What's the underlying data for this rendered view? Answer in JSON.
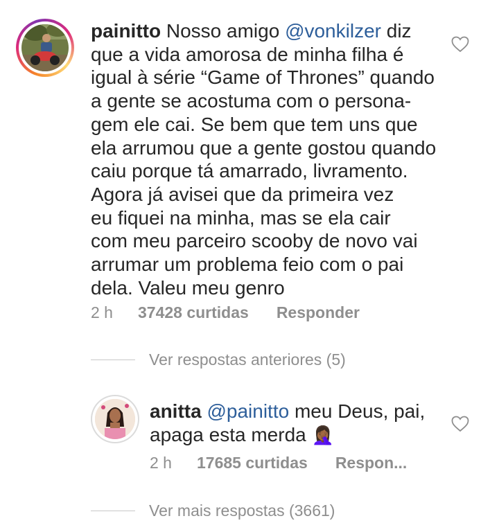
{
  "comment1": {
    "username": "painitto",
    "text_before_mention": "Nosso amigo ",
    "mention": "@vonkilzer",
    "text_after_mention": " diz\nque a vida amorosa de minha filha é\nigual à série “Game of Thrones” quando\na gente se acostuma com o persona-\ngem ele cai. Se bem que tem uns que\nela arrumou que a gente gostou quando\ncaiu porque tá amarrado, livramento.\nAgora já avisei que da primeira vez\neu fiquei na minha, mas se ela cair\ncom meu parceiro scooby de novo vai\narrumar um problema feio com o pai\ndela. Valeu meu genro",
    "time": "2 h",
    "likes": "37428 curtidas",
    "reply": "Responder",
    "like_icon": "heart-outline-icon"
  },
  "previous_replies": "Ver respostas anteriores (5)",
  "comment2": {
    "username": "anitta",
    "mention": "@painitto",
    "text": " meu Deus, pai,\napaga esta merda ",
    "emoji": "🤦🏾‍♀️",
    "time": "2 h",
    "likes": "17685 curtidas",
    "reply": "Respon...",
    "like_icon": "heart-outline-icon"
  },
  "more_replies": "Ver mais respostas (3661)",
  "colors": {
    "text": "#262626",
    "secondary": "#8e8e8e",
    "mention": "#2d5e9a",
    "divider": "#c7c7c7"
  }
}
